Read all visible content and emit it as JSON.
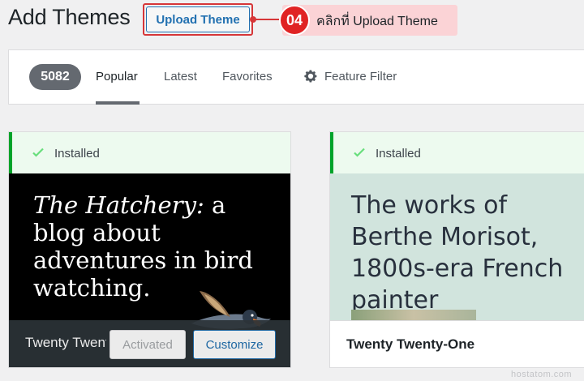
{
  "header": {
    "title": "Add Themes",
    "upload_button_label": "Upload Theme"
  },
  "annotation": {
    "step_number": "04",
    "instruction": "คลิกที่ Upload Theme",
    "accent_color": "#e02424"
  },
  "filter_bar": {
    "theme_count": "5082",
    "tabs": [
      "Popular",
      "Latest",
      "Favorites"
    ],
    "active_tab": "Popular",
    "feature_filter_label": "Feature Filter",
    "feature_filter_icon": "gear-icon"
  },
  "themes": [
    {
      "status": "Installed",
      "preview_text_italic": "The Hatchery:",
      "preview_text_rest": " a blog about adventures in bird watching.",
      "name": "Twenty Twenty-Two",
      "activated_label": "Activated",
      "customize_label": "Customize"
    },
    {
      "status": "Installed",
      "preview_text": "The works of Berthe Morisot, 1800s-era French painter",
      "name": "Twenty Twenty-One"
    }
  ],
  "watermark": "hostatom.com"
}
